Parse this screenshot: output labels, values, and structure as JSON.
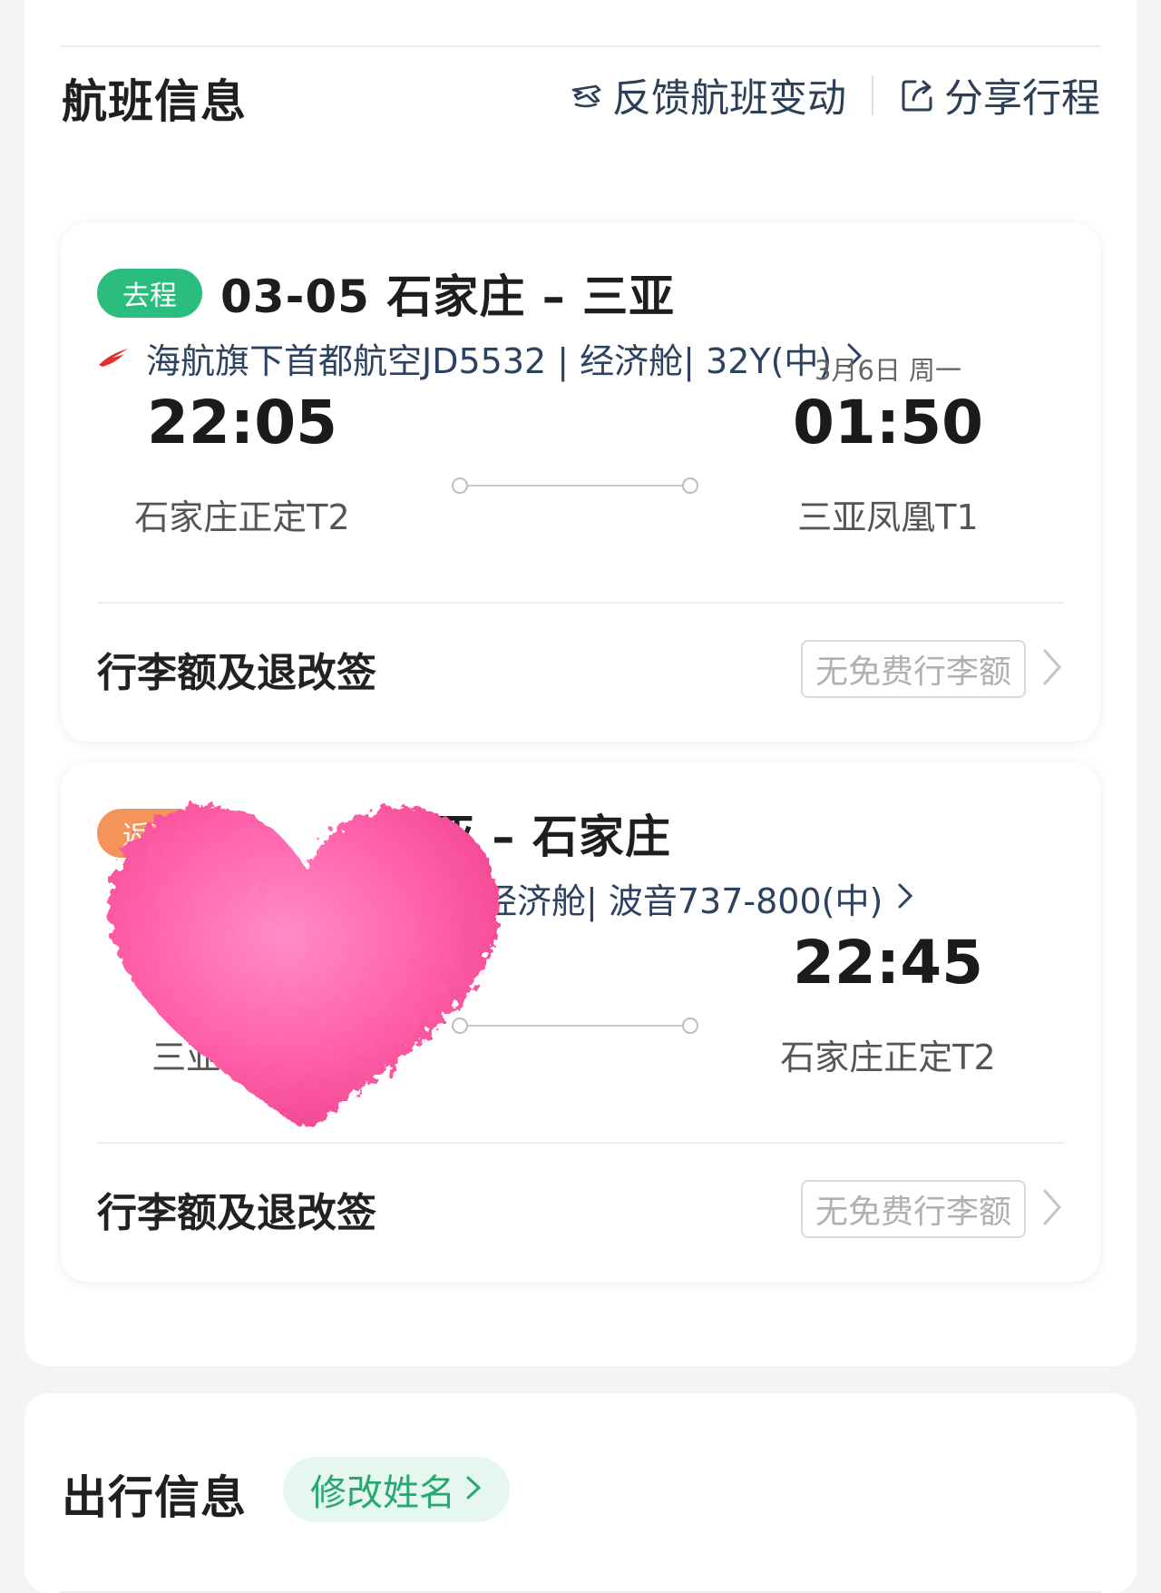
{
  "flight_section": {
    "title": "航班信息",
    "feedback_label": "反馈航班变动",
    "share_label": "分享行程"
  },
  "outbound": {
    "tag": "去程",
    "route": "03-05 石家庄 – 三亚",
    "flight_info": "海航旗下首都航空JD5532 | 经济舱| 32Y(中)",
    "depart_time": "22:05",
    "depart_airport": "石家庄正定T2",
    "arrive_date": "3月6日 周一",
    "arrive_time": "01:50",
    "arrive_airport": "三亚凤凰T1",
    "baggage_title": "行李额及退改签",
    "baggage_badge": "无免费行李额"
  },
  "return": {
    "tag": "返程",
    "route": "亚 – 石家庄",
    "flight_info": "经济舱| 波音737-800(中)",
    "depart_airport": "三亚凤凰T1",
    "arrive_time": "22:45",
    "arrive_airport": "石家庄正定T2",
    "baggage_title": "行李额及退改签",
    "baggage_badge": "无免费行李额"
  },
  "travel_section": {
    "title": "出行信息",
    "edit_name_label": "修改姓名"
  },
  "colors": {
    "accent_green": "#2bbd7e",
    "return_tag_orange": "#f5945a",
    "link_blue": "#2d4260",
    "heart_pink": "#ff5fa8"
  },
  "icons": [
    "plane-feedback-icon",
    "share-icon",
    "airline-logo-icon",
    "chevron-right-icon"
  ]
}
